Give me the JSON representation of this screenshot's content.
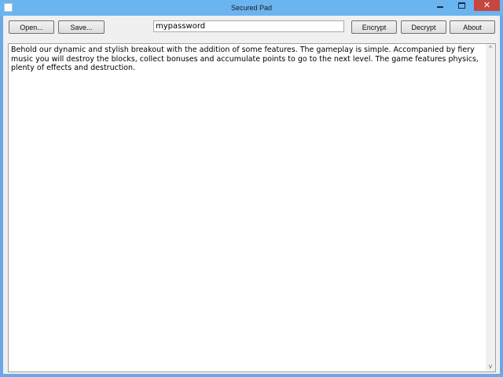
{
  "window": {
    "title": "Secured Pad",
    "close_glyph": "✕"
  },
  "toolbar": {
    "open_label": "Open...",
    "save_label": "Save...",
    "encrypt_label": "Encrypt",
    "decrypt_label": "Decrypt",
    "about_label": "About"
  },
  "password": {
    "value": "mypassword"
  },
  "editor": {
    "text": "Behold our dynamic and stylish breakout with the addition of some features. The gameplay is simple. Accompanied by fiery music you will destroy the blocks, collect bonuses and accumulate points to go to the next level. The game features physics, plenty of effects and destruction."
  },
  "scrollbar": {
    "up_glyph": "^",
    "down_glyph": "v"
  },
  "colors": {
    "titlebar": "#6ab4f0",
    "close_button": "#c7463f",
    "background": "#f0f0f0"
  },
  "icons": [
    "app-icon",
    "minimize-icon",
    "maximize-icon",
    "close-icon",
    "scroll-up-icon",
    "scroll-down-icon"
  ]
}
